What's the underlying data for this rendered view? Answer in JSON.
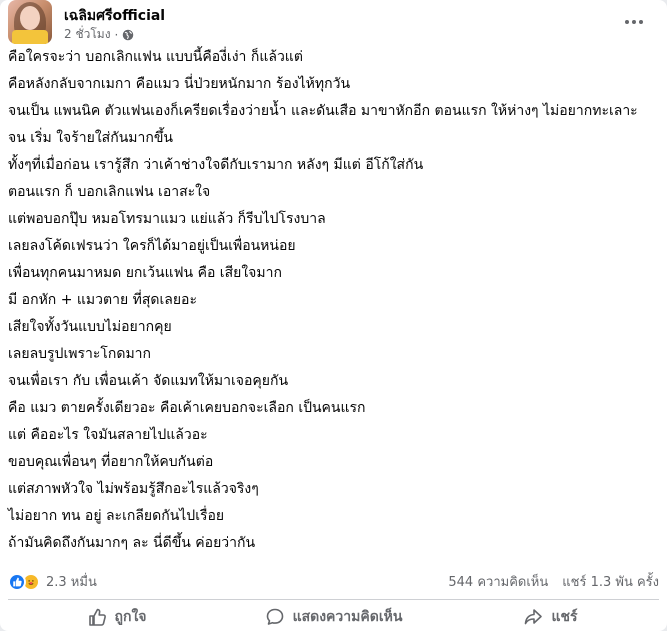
{
  "post": {
    "page_name": "เฉลิมศรีofficial",
    "time": "2 ชั่วโมง",
    "separator": "·",
    "privacy_icon": "globe-icon",
    "menu_icon": "more-horizontal-icon",
    "lines": [
      "คือใครจะว่า บอกเลิกแฟน แบบนี้คืองี่เง่า ก็แล้วแต่",
      "คือหลังกลับจากเมกา คือแมว นี่ป่วยหนักมาก ร้องไห้ทุกวัน",
      "จนเป็น แพนนิค ตัวแฟนเองก็เครียดเรื่องว่ายน้ำ และดันเสือ    มาขาหักอีก ตอนแรก ให้ห่างๆ ไม่อยากทะเลาะ",
      "จน เริ่ม ใจร้ายใส่กันมากขึ้น",
      "ทั้งๆที่เมื่อก่อน เรารู้สึก ว่าเค้าช่างใจดีกับเรามาก หลังๆ มีแต่ อีโก้ใส่กัน",
      "ตอนแรก ก็ บอกเลิกแฟน เอาสะใจ",
      "แต่พอบอกปุ๊บ หมอโทรมาแมว แย่แล้ว ก็รีบไปโรงบาล",
      "เลยลงโค้ดเฟรนว่า ใครก็ได้มาอยู่เป็นเพื่อนหน่อย",
      "เพื่อนทุกคนมาหมด ยกเว้นแฟน คือ เสียใจมาก",
      "มี    อกหัก + แมวตาย ที่สุดเลยอะ",
      "เสียใจทั้งวันแบบไม่อยากคุย",
      "เลยลบรูปเพราะโกดมาก",
      "จนเพื่อเรา กับ เพื่อนเค้า จัดแมทให้มาเจอคุยกัน",
      "คือ แมว    ตายครั้งเดียวอะ คือเค้าเคยบอกจะเลือก    เป็นคนแรก",
      "แต่ คืออะไร ใจมันสลายไปแล้วอะ",
      "ขอบคุณเพื่อนๆ ที่อยากให้คบกันต่อ",
      "แต่สภาพหัวใจ     ไม่พร้อมรู้สึกอะไรแล้วจริงๆ",
      "ไม่อยาก ทน อยู่ ละเกลียดกันไปเรื่อย",
      "ถ้ามันคิดถึงกันมากๆ ละ นี่ดีขึ้น ค่อยว่ากัน"
    ]
  },
  "stats": {
    "reaction_count": "2.3 หมื่น",
    "comments": "544 ความคิดเห็น",
    "shares": "แชร์ 1.3 พัน ครั้ง",
    "reaction_icons": [
      "like-icon",
      "care-icon"
    ],
    "colors": {
      "like": "#1877f2",
      "care": "#f7b928"
    }
  },
  "actions": {
    "like": "ถูกใจ",
    "comment": "แสดงความคิดเห็น",
    "share": "แชร์"
  }
}
